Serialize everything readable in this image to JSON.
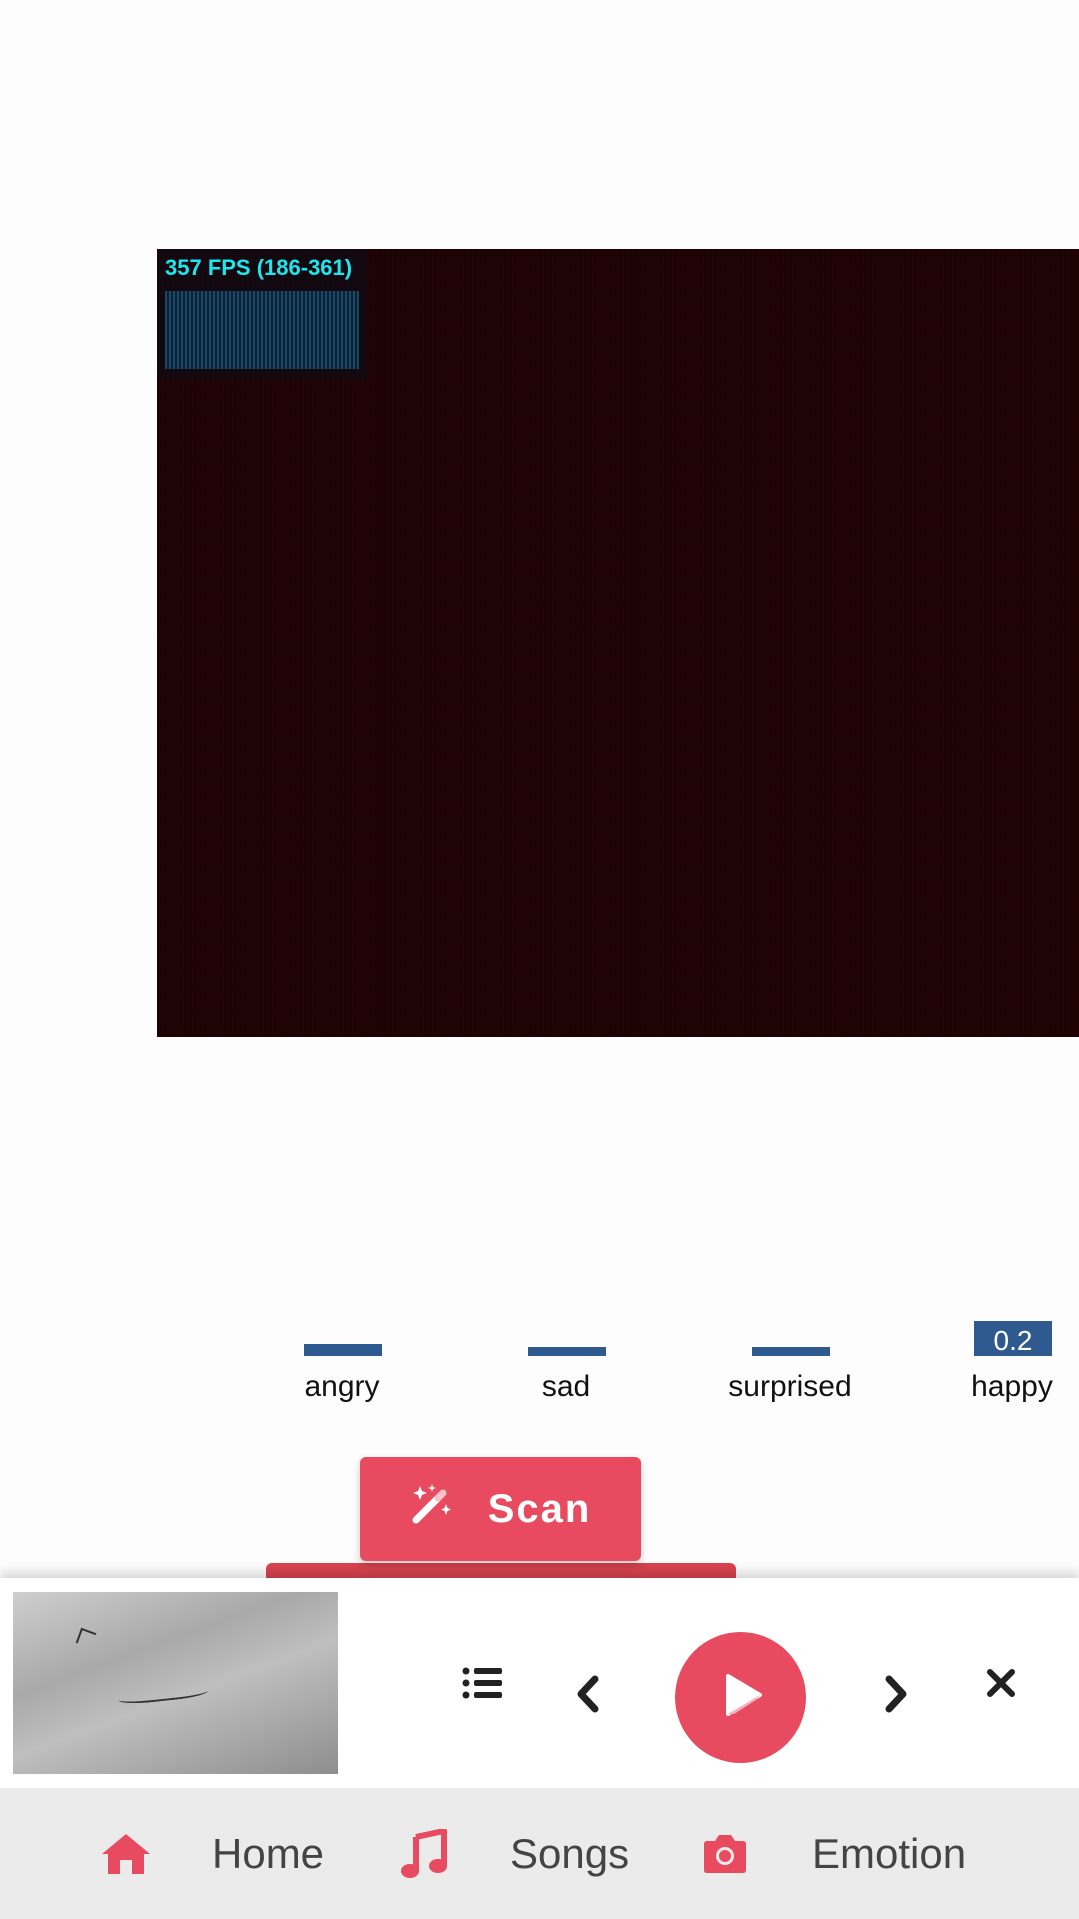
{
  "camera": {
    "fps_text": "357 FPS (186-361)"
  },
  "emotions": [
    {
      "label": "angry",
      "value": 0.02,
      "value_text": ""
    },
    {
      "label": "sad",
      "value": 0.015,
      "value_text": ""
    },
    {
      "label": "surprised",
      "value": 0.015,
      "value_text": ""
    },
    {
      "label": "happy",
      "value": 0.06,
      "value_text": "0.2"
    }
  ],
  "scan": {
    "label": "Scan",
    "icon": "magic-wand-icon"
  },
  "player": {
    "thumbnail_icon": "album-art",
    "controls": [
      "playlist-icon",
      "previous-icon",
      "play-icon",
      "next-icon",
      "close-icon"
    ]
  },
  "nav": {
    "items": [
      {
        "label": "Home",
        "icon": "home-icon"
      },
      {
        "label": "Songs",
        "icon": "music-note-icon"
      },
      {
        "label": "Emotion",
        "icon": "camera-icon"
      }
    ]
  },
  "colors": {
    "accent": "#e84a5f",
    "bar": "#2f5a8f",
    "fps_text": "#1ee6ee",
    "nav_bg": "#ebebeb"
  }
}
